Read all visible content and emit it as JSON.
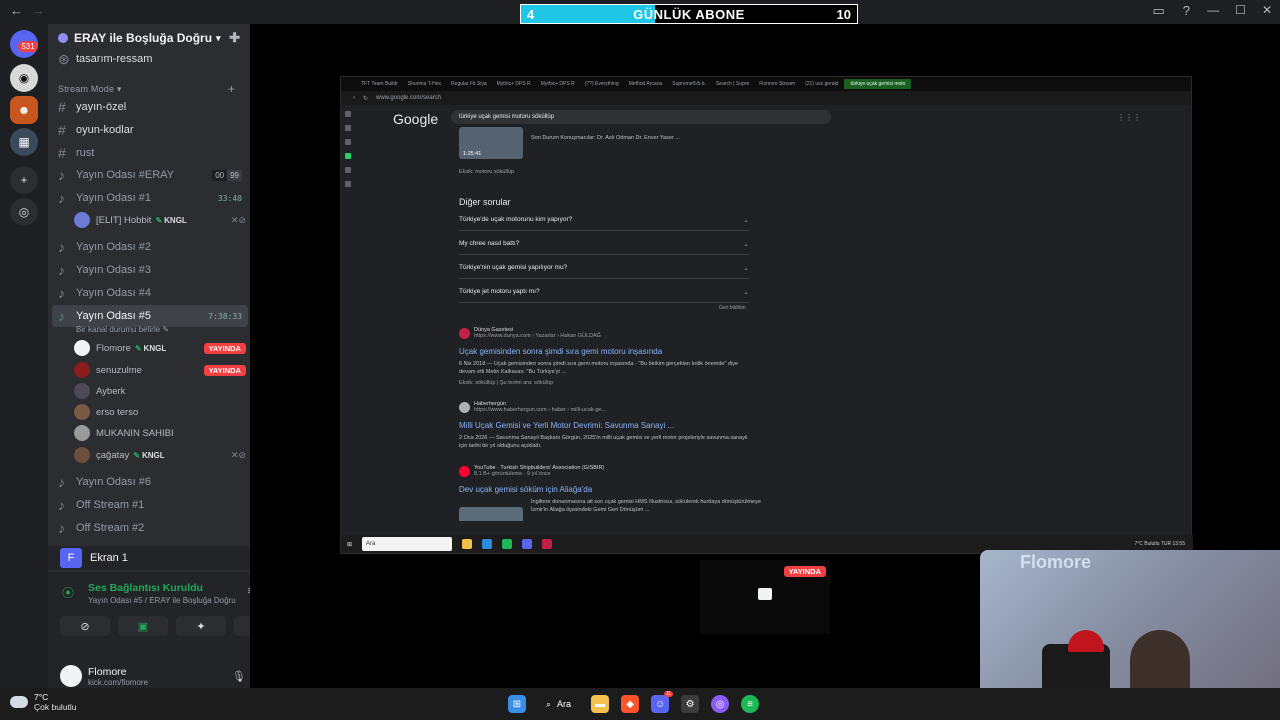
{
  "overlay": {
    "left_value": "4",
    "title": "GÜNLÜK ABONE",
    "right_value": "10",
    "progress": 0.4
  },
  "window": {
    "nav_back": "←",
    "nav_fwd": "→",
    "controls": [
      "—",
      "☐",
      "✕"
    ]
  },
  "rail": {
    "badge": "531"
  },
  "server": {
    "name": "ERAY ile Boşluğa Doğru"
  },
  "channels_top": [
    {
      "prefix": "#",
      "label": "tasarım-ressam"
    }
  ],
  "category": {
    "label": "Stream Mode"
  },
  "text_channels": [
    {
      "label": "yayın-özel"
    },
    {
      "label": "oyun-kodlar"
    },
    {
      "label": "rust"
    }
  ],
  "voice_channels": {
    "eray": {
      "label": "Yayın Odası #ERAY",
      "limit": [
        "00",
        "99"
      ]
    },
    "one": {
      "label": "Yayın Odası #1",
      "time": "33:40",
      "user": "[ELIT] Hobbit",
      "user_tag": "KNGL"
    },
    "two": {
      "label": "Yayın Odası #2"
    },
    "three": {
      "label": "Yayın Odası #3"
    },
    "four": {
      "label": "Yayın Odası #4"
    },
    "five": {
      "label": "Yayın Odası #5",
      "time": "7:38:33",
      "status": "Bir kanal durumu belirle",
      "users": [
        {
          "name": "Flomore",
          "tag": "KNGL",
          "live": "YAYINDA"
        },
        {
          "name": "senuzulme",
          "live": "YAYINDA"
        },
        {
          "name": "Ayberk"
        },
        {
          "name": "erso terso"
        },
        {
          "name": "MUKANIN SAHIBI"
        },
        {
          "name": "çağatay",
          "tag": "KNGL"
        }
      ]
    },
    "six": {
      "label": "Yayın Odası #6"
    },
    "off1": {
      "label": "Off Stream #1"
    },
    "off2": {
      "label": "Off Stream #2"
    }
  },
  "screen_panel": {
    "initial": "F",
    "label": "Ekran 1"
  },
  "voice_panel": {
    "title": "Ses Bağlantısı Kuruldu",
    "subtitle": "Yayın Odası #5 / ERAY ile Boşluğa Doğru"
  },
  "user_panel": {
    "name": "Flomore",
    "status": "kick.com/flomore"
  },
  "browser": {
    "tabs": [
      "TFT Team Buildr",
      "Shurima T-Hex",
      "Regular Fit Siya",
      "Mythic+ DPS R",
      "Mythic+ DPS R",
      "(??) Everything",
      "Method Arcana",
      "Supreme®/b.b.",
      "Search | Supre",
      "Flomore Stream",
      "(21) uss gerald",
      "türkiye uçak gemisi moto"
    ],
    "url": "www.google.com/search",
    "google_logo": "Google",
    "query": "türkiye uçak gemisi motoru söküllüp",
    "top_snippet": "Son Durum Konuşmacılar: Dr. Aslı Odman Dr. Enver Yaser ...",
    "top_duration": "1:25:41",
    "top_missing": "Eksik: motoru söküllüp",
    "paa_title": "Diğer sorular",
    "paa": [
      "Türkiye'de uçak motorunu kim yapıyor?",
      "My chree nasıl battı?",
      "Türkiye'nin uçak gemisi yapılıyor mu?",
      "Türkiye jet motoru yaptı mı?"
    ],
    "feedback": "Geri bildirim",
    "results": [
      {
        "source": "Dünya Gazetesi",
        "url": "https://www.dunya.com › Yazarlar › Hakan GÜLDAĞ",
        "title": "Uçak gemisinden sonra şimdi sıra gemi motoru inşasında",
        "snippet": "6 Nis 2018 — Uçak gemisinden sonra şimdi sıra gemi motoru inşasında · \"Bu birikim gerçekten kritik önemde\" diye devam etti Metin Kalkavan. \"Bu Türkiye'yi ...",
        "missing": "Eksik: söküllüp | Şu terimi ara: sökülüp"
      },
      {
        "source": "Haberhergün",
        "url": "https://www.haberhergun.com › haber › milli-ucak-ge...",
        "title": "Milli Uçak Gemisi ve Yerli Motor Devrimi: Savunma Sanayi ...",
        "snippet": "2 Oca 2026 — Savunma Sanayii Başkanı Görgün, 2025'in milli uçak gemisi ve yerli motor projeleriyle savunma sanayii için tarihi bir yıl olduğunu açıkladı."
      },
      {
        "source": "YouTube · Turkish Shipbuilders' Association (GISBIR)",
        "url": "8,1 B+ görüntüleme · 9 yıl önce",
        "title": "Dev uçak gemisi söküm için Aliağa'da",
        "snippet": "İngiltere donanmasına ait son uçak gemisi HMS Illustrious, sökülerek hurdaya dönüştürülmeye İzmir'in Aliağa ilçesindeki Gemi Geri Dönüşüm ...",
        "duration": "1:11"
      }
    ],
    "taskbar_search": "Ara",
    "tray": "7°C Bulutlu   TUR  13:55"
  },
  "mini_tile": {
    "live": "YAYINDA"
  },
  "cam": {
    "name": "Flomore"
  },
  "taskbar": {
    "temp": "7°C",
    "weather": "Çok bulutlu",
    "search": "Ara",
    "discord_badge": "11"
  },
  "colors": {
    "accent": "#5865f2",
    "live": "#f23f43",
    "online": "#23a55a",
    "overlay_fill": "#1fc6e6"
  }
}
